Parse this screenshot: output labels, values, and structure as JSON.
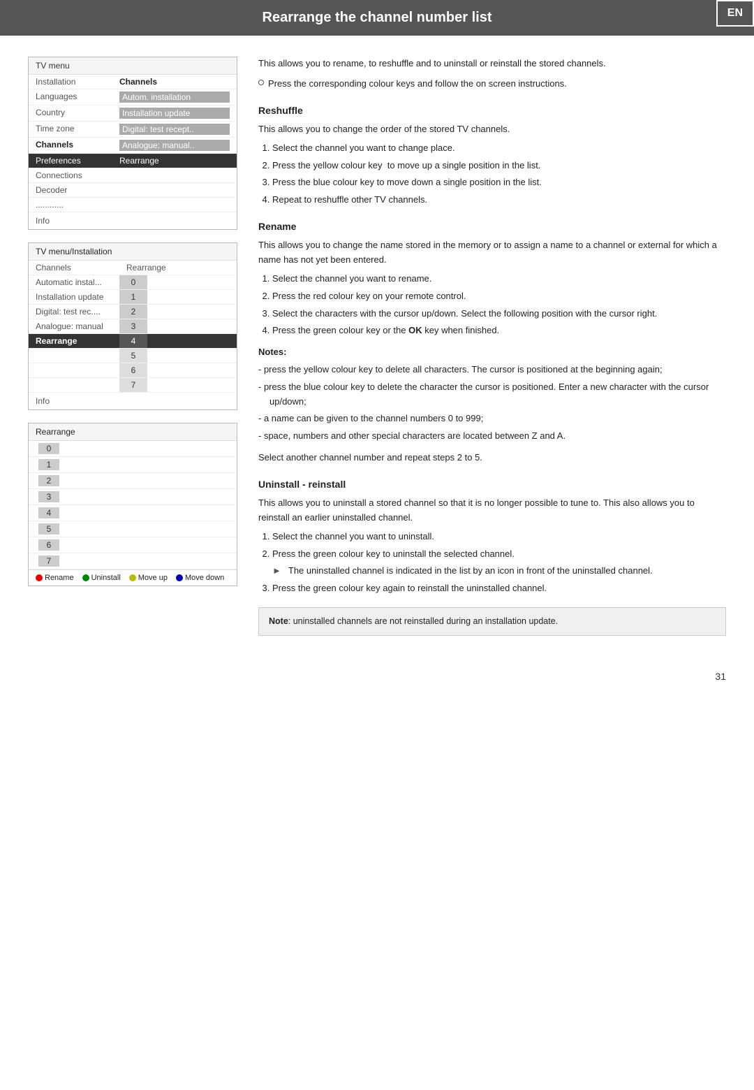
{
  "header": {
    "title": "Rearrange the channel number list",
    "en_label": "EN"
  },
  "tv_menu": {
    "title": "TV menu",
    "rows": [
      {
        "left": "Installation",
        "right": "Channels",
        "left_bold": false,
        "right_bold": true,
        "selected": false
      },
      {
        "left": "Languages",
        "right": "Autom. installation",
        "left_bold": false,
        "right_bold": false,
        "selected": false,
        "right_highlighted": true
      },
      {
        "left": "Country",
        "right": "Installation update",
        "left_bold": false,
        "right_bold": false,
        "selected": false,
        "right_highlighted": true
      },
      {
        "left": "Time zone",
        "right": "Digital: test recept..",
        "left_bold": false,
        "right_bold": false,
        "selected": false,
        "right_highlighted": true
      },
      {
        "left": "Channels",
        "right": "Analogue: manual..",
        "left_bold": true,
        "right_bold": false,
        "selected": false,
        "right_highlighted": true
      },
      {
        "left": "Preferences",
        "right": "Rearrange",
        "left_bold": false,
        "right_bold": false,
        "selected": true
      },
      {
        "left": "Connections",
        "right": "",
        "left_bold": false,
        "right_bold": false,
        "selected": false
      },
      {
        "left": "Decoder",
        "right": "",
        "left_bold": false,
        "right_bold": false,
        "selected": false
      },
      {
        "left": "............",
        "right": "",
        "left_bold": false,
        "right_bold": false,
        "selected": false
      }
    ],
    "info": "Info"
  },
  "installation_menu": {
    "title": "TV menu/Installation",
    "rows": [
      {
        "left": "Channels",
        "right": "Rearrange",
        "left_bold": false,
        "right_bold": false,
        "header": true
      },
      {
        "left": "Automatic instal...",
        "right": "0",
        "selected": false
      },
      {
        "left": "Installation update",
        "right": "1",
        "selected": false
      },
      {
        "left": "Digital: test rec....",
        "right": "2",
        "selected": false
      },
      {
        "left": "Analogue: manual",
        "right": "3",
        "selected": false
      },
      {
        "left": "Rearrange",
        "right": "4",
        "selected": true
      },
      {
        "left": "",
        "right": "5",
        "selected": false
      },
      {
        "left": "",
        "right": "6",
        "selected": false
      },
      {
        "left": "",
        "right": "7",
        "selected": false
      }
    ],
    "info": "Info"
  },
  "rearrange_box": {
    "title": "Rearrange",
    "numbers": [
      "0",
      "1",
      "2",
      "3",
      "4",
      "5",
      "6",
      "7"
    ]
  },
  "legend": {
    "items": [
      {
        "color": "red",
        "label": "Rename"
      },
      {
        "color": "green",
        "label": "Uninstall"
      },
      {
        "color": "yellow",
        "label": "Move up"
      },
      {
        "color": "blue",
        "label": "Move down"
      }
    ]
  },
  "content": {
    "intro": "This allows you to rename, to reshuffle and to uninstall or reinstall the stored channels.",
    "bullet1": "Press the corresponding colour keys and follow the on screen instructions.",
    "reshuffle": {
      "heading": "Reshuffle",
      "intro": "This allows you to change the order of the stored TV channels.",
      "steps": [
        "Select the channel you want to change place.",
        "Press the yellow colour key  to move up a single position in the list.",
        "Press the blue colour key to move down a single position in the list.",
        "Repeat to reshuffle other TV channels."
      ]
    },
    "rename": {
      "heading": "Rename",
      "intro": "This allows you to change the name stored in the memory or to assign a name to a channel or external for which a name has not yet been entered.",
      "steps": [
        "Select the channel you want to rename.",
        "Press the red colour key on your remote control.",
        "Select the characters with the cursor up/down. Select the following position with the cursor right.",
        "Press the green colour key or the OK key when finished."
      ],
      "notes_title": "Notes:",
      "notes": [
        "- press the yellow colour key to delete all characters. The cursor is positioned at the beginning again;",
        "- press the blue colour key to delete the character the cursor is positioned. Enter a new character with the cursor up/down;",
        "- a name can be given to the channel numbers 0 to 999;",
        "- space, numbers and other special characters are located between Z and A."
      ]
    },
    "step5": "Select another channel number and repeat steps 2 to 5.",
    "uninstall": {
      "heading": "Uninstall - reinstall",
      "intro": "This allows you to uninstall a stored channel so that it is no longer possible to tune to. This also allows you to reinstall an earlier uninstalled channel.",
      "steps": [
        "Select the channel you want to uninstall.",
        "Press the green colour key to uninstall the selected channel.",
        "Press the green colour key again to reinstall the uninstalled channel."
      ],
      "sub_bullet": "The uninstalled channel is indicated in the list by an icon in front of the uninstalled channel.",
      "note_callout": "Note: uninstalled channels are not reinstalled during an installation update."
    }
  },
  "page_number": "31"
}
